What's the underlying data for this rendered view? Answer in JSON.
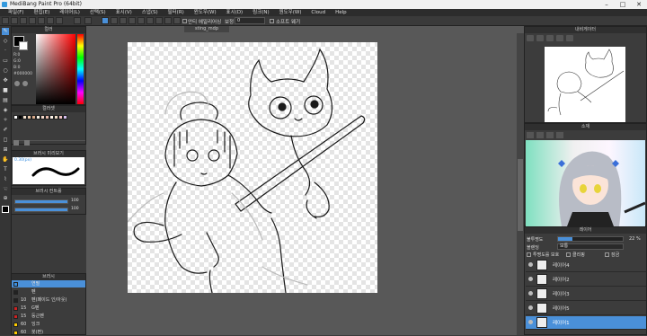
{
  "window": {
    "title": "MediBang Paint Pro (64bit)",
    "min": "–",
    "max": "□",
    "close": "✕"
  },
  "menu": [
    "파일(F)",
    "편집(E)",
    "레이어(L)",
    "선택(S)",
    "표시(V)",
    "스냅(S)",
    "필터(R)",
    "윈도우(W)",
    "표시(D)",
    "링크(N)",
    "원도우(W)",
    "Cloud",
    "Help"
  ],
  "toolbar": {
    "antialias_label": "안티 에일리어싱",
    "correction_label": "보정",
    "correction_value": "0",
    "soft_label": "소프트 웨기"
  },
  "document_tab": "sting_mdp",
  "panels": {
    "color": {
      "title": "컬러",
      "hex": "#000000",
      "r_label": "R:0",
      "g_label": "G:0",
      "b_label": "B:0"
    },
    "palette": {
      "title": "컬러셋"
    },
    "brush_control": {
      "title": "브러시 미리보기",
      "size_value": "0.30(px)"
    },
    "brush_opacity": {
      "title": "브러시 컨트롤",
      "pct1": "100",
      "pct2": "100"
    },
    "brush_list": {
      "title": "브러시",
      "items": [
        {
          "num": "",
          "name": "연필",
          "color": "#3a8fe0"
        },
        {
          "num": "",
          "name": "펜",
          "color": "#222222"
        },
        {
          "num": "10",
          "name": "펜(페이드 인/아웃)",
          "color": "#222222"
        },
        {
          "num": "15",
          "name": "G펜",
          "color": "#cc2222"
        },
        {
          "num": "15",
          "name": "둥근펜",
          "color": "#cc2222"
        },
        {
          "num": "60",
          "name": "잉크",
          "color": "#ffcc00"
        },
        {
          "num": "60",
          "name": "붓(편)",
          "color": "#ffcc00"
        }
      ]
    },
    "navigator": {
      "title": "내비게이터"
    },
    "material": {
      "title": "소재"
    },
    "layers": {
      "title": "레이어",
      "opacity_label": "불투명도",
      "opacity_value": "22 %",
      "blend_label": "블렌딩",
      "blend_value": "보통",
      "protect_label": "투명도를 보호",
      "clip_label": "클리핑",
      "lock_label": "잠금",
      "items": [
        {
          "name": "레이어4",
          "selected": false
        },
        {
          "name": "레이어2",
          "selected": false
        },
        {
          "name": "레이어3",
          "selected": false
        },
        {
          "name": "레이어5",
          "selected": false
        },
        {
          "name": "레이어1",
          "selected": true
        }
      ]
    }
  }
}
